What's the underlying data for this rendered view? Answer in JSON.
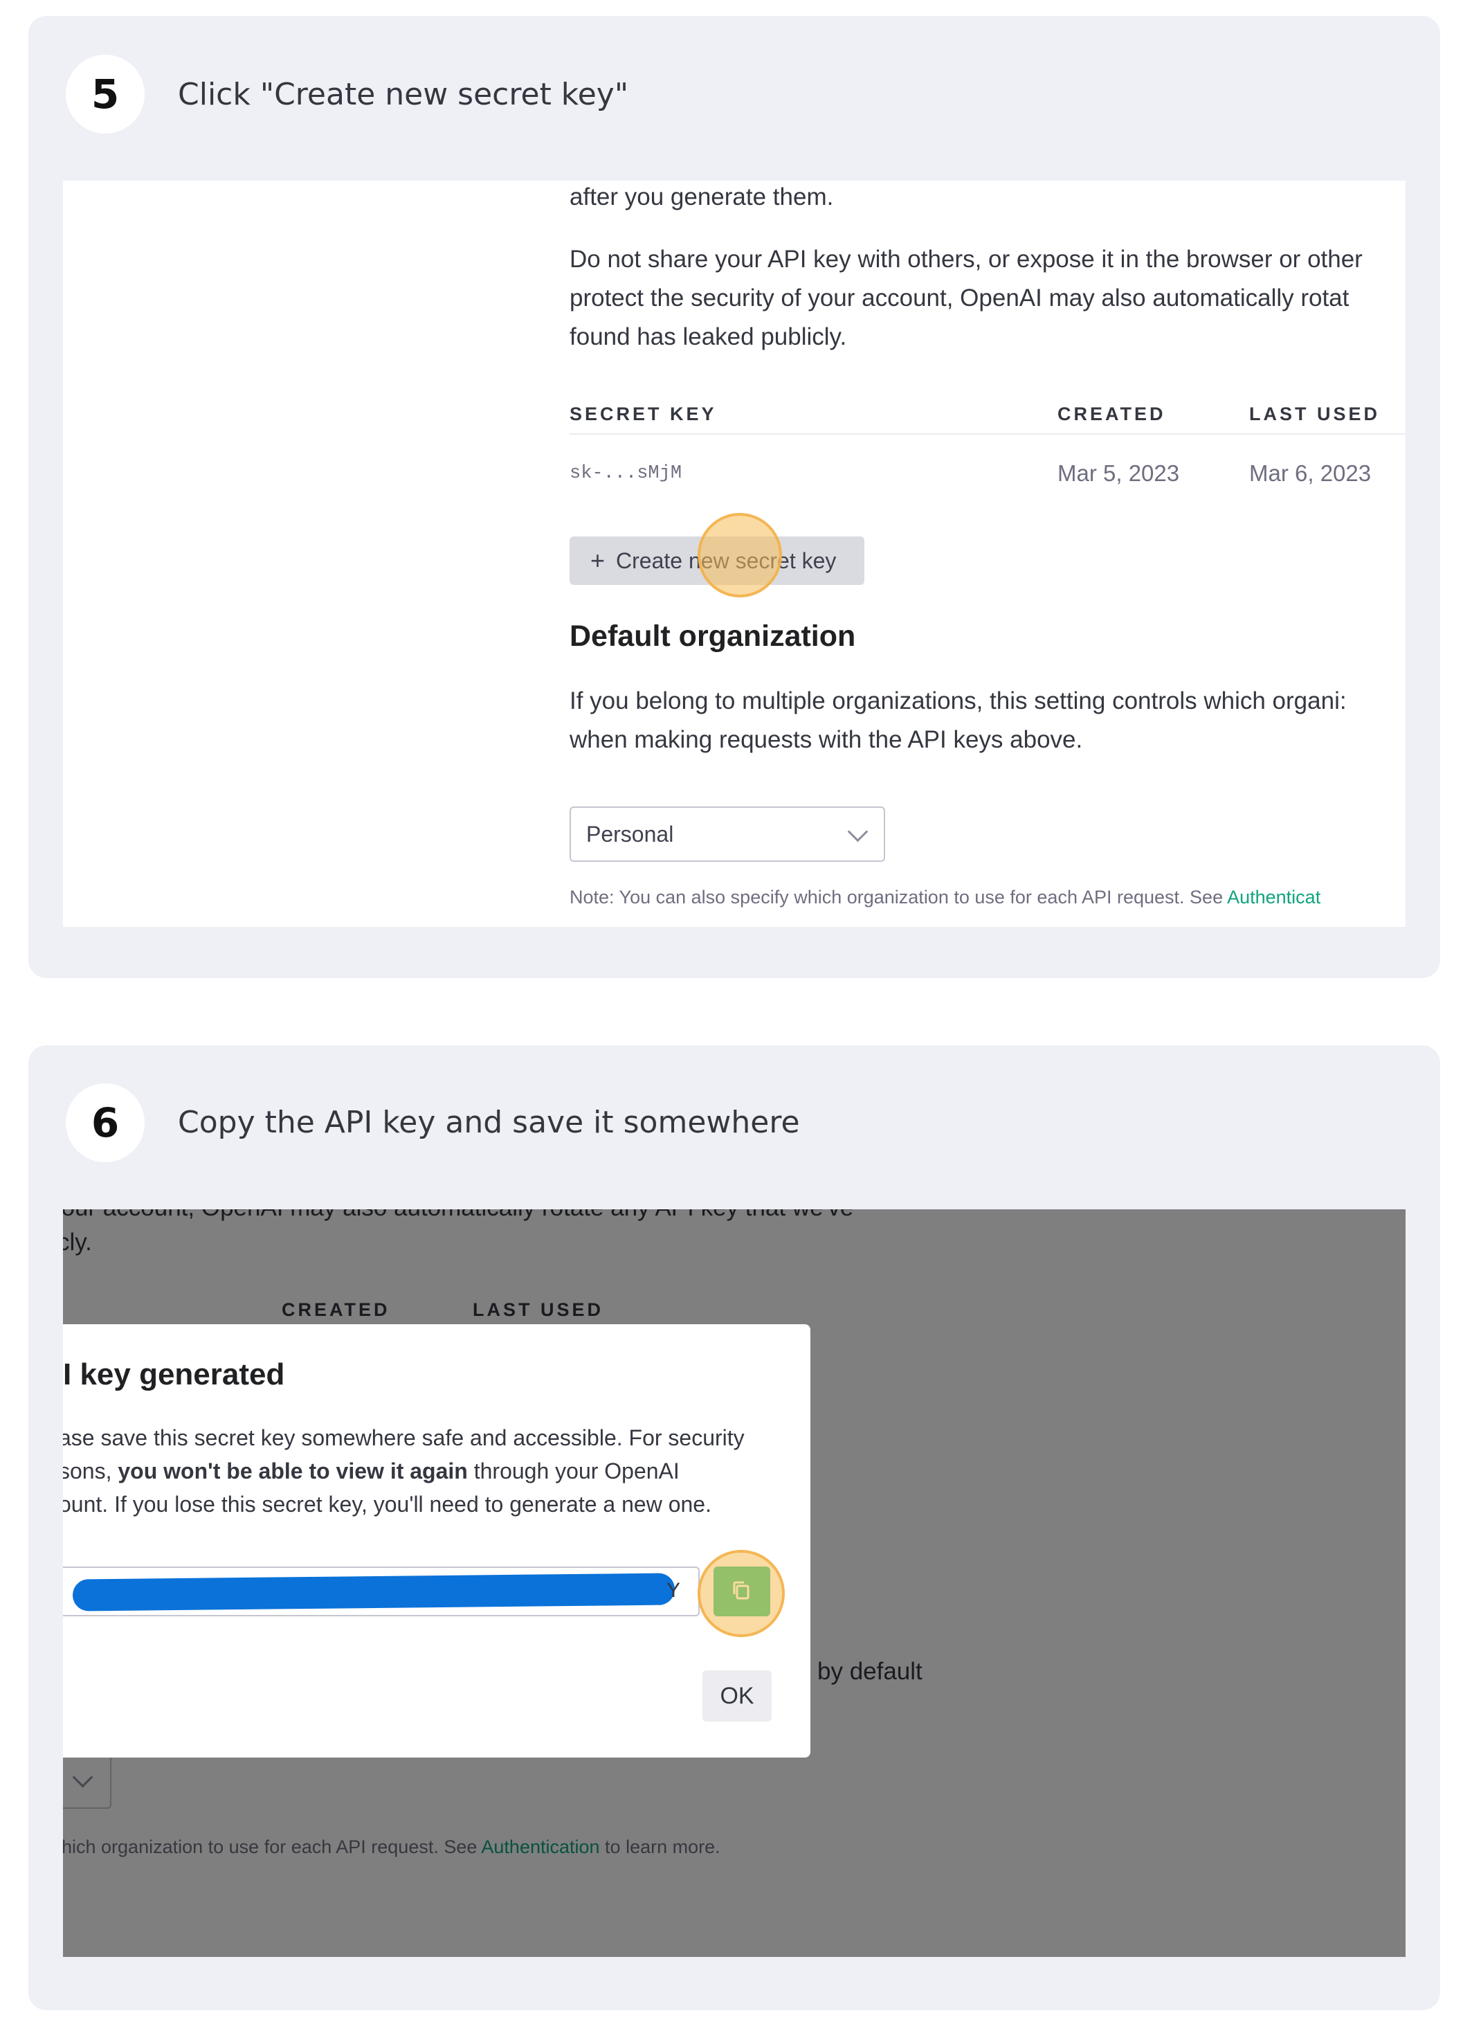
{
  "step5": {
    "number": "5",
    "title": "Click \"Create new secret key\"",
    "screenshot": {
      "intro_tail": "after you generate them.",
      "warning_lines": [
        "Do not share your API key with others, or expose it in the browser or other",
        "protect the security of your account, OpenAI may also automatically rotat",
        "found has leaked publicly."
      ],
      "columns": [
        "SECRET KEY",
        "CREATED",
        "LAST USED"
      ],
      "row": {
        "key": "sk-...sMjM",
        "created": "Mar 5, 2023",
        "last_used": "Mar 6, 2023"
      },
      "create_button": {
        "plus": "+",
        "label": "Create new secret key"
      },
      "default_org_heading": "Default organization",
      "default_org_lines": [
        "If you belong to multiple organizations, this setting controls which organi:",
        "when making requests with the API keys above."
      ],
      "select_value": "Personal",
      "note_prefix": "Note: You can also specify which organization to use for each API request. See",
      "note_link": "Authenticat"
    }
  },
  "step6": {
    "number": "6",
    "title": "Copy the API key and save it somewhere",
    "screenshot": {
      "bg_top_text": "your account, OpenAI may also automatically rotate any API key that we've",
      "bg_cly": "cly.",
      "bg_columns": [
        "CREATED",
        "LAST USED"
      ],
      "bg_by_default": "by default",
      "bg_note_prefix": "hich organization to use for each API request. See",
      "bg_note_link": "Authentication",
      "bg_note_suffix": "to learn more.",
      "modal": {
        "title": "I key generated",
        "line1": "ase save this secret key somewhere safe and accessible. For security",
        "line2_prefix": "sons,",
        "line2_bold": "you won't be able to view it again",
        "line2_suffix": "through your OpenAI",
        "line3": "ount. If you lose this secret key, you'll need to generate a new one.",
        "key_tail": "Y",
        "ok_label": "OK"
      }
    }
  },
  "colors": {
    "card_bg": "#eef0f6",
    "link": "#10a37f",
    "redaction": "#0a72d9",
    "copy_button": "#19c37d",
    "highlight": "#f7be5a"
  }
}
